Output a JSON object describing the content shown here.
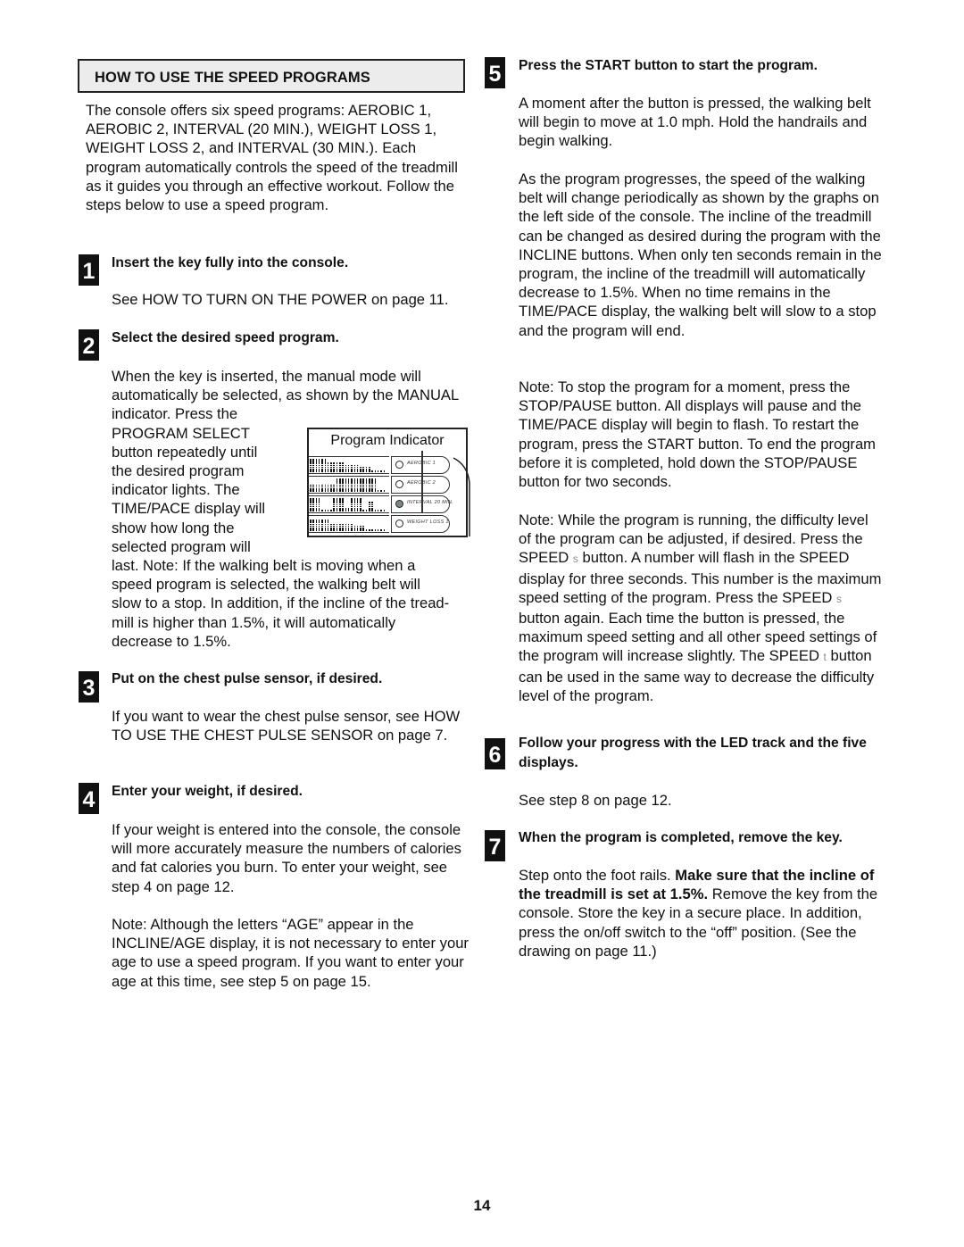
{
  "section_header": "HOW TO USE THE SPEED PROGRAMS",
  "intro": "The console offers six speed programs: AEROBIC 1, AEROBIC 2, INTERVAL (20 MIN.), WEIGHT LOSS 1, WEIGHT LOSS 2, and INTERVAL (30 MIN.). Each program automatically controls the speed of the treadmill as it guides you through an effective workout. Follow the steps below to use a speed program.",
  "steps": [
    {
      "number": "1",
      "title": "Insert the key fully into the console.",
      "body": [
        "See HOW TO TURN ON THE POWER on page 11."
      ]
    },
    {
      "number": "2",
      "title": "Select the desired speed program.",
      "body_lines": [
        "When the key is inserted, the manual mode will",
        "automatically be selected, as shown by the MANUAL",
        "indicator. Press the",
        "PROGRAM SELECT",
        "button repeatedly until",
        "the desired program",
        "indicator lights. The",
        "TIME/PACE display will",
        "show how long the",
        "selected program will",
        "last. Note: If the walking belt is moving when a",
        "speed program is selected, the walking belt will",
        "slow to a stop. In addition, if the incline of the tread-",
        "mill is higher than 1.5%, it will automatically",
        "decrease to 1.5%."
      ]
    },
    {
      "number": "3",
      "title": "Put on the chest pulse sensor, if desired.",
      "body": [
        "If you want to wear the chest pulse sensor, see HOW TO USE THE CHEST PULSE SENSOR on page 7."
      ]
    },
    {
      "number": "4",
      "title": "Enter your weight, if desired.",
      "body": [
        "If your weight is entered into the console, the console will more accurately measure the numbers of calories and fat calories you burn. To enter your weight, see step 4 on page 12.",
        "Note: Although the letters “AGE” appear in the INCLINE/AGE display, it is not necessary to enter your age to use a speed program. If you want to enter your age at this time, see step 5 on page 15."
      ]
    },
    {
      "number": "5",
      "title": "Press the START button to start the program.",
      "body": [
        "A moment after the button is pressed, the walking belt will begin to move at 1.0 mph. Hold the handrails and begin walking.",
        "As the program progresses, the speed of the walking belt will change periodically as shown by the graphs on the left side of the console. The incline of the treadmill can be changed as desired during the program with the INCLINE buttons. When only ten seconds remain in the program, the incline of the treadmill will automatically decrease to 1.5%. When no time remains in the TIME/PACE display, the walking belt will slow to a stop and the program will end.",
        "Note: To stop the program for a moment, press the STOP/PAUSE button. All displays will pause and the TIME/PACE display will begin to flash. To restart the program, press the START button. To end the program before it is completed, hold down the STOP/PAUSE button for two seconds."
      ],
      "speed_note": {
        "part1": "Note: While the program is running, the difficulty level of the program can be adjusted, if desired. Press the SPEED ",
        "up_glyph": "s",
        "part2": " button. A number will flash in the SPEED display for three seconds. This number is the maximum speed setting of the program. Press the SPEED ",
        "part3": " button again. Each time the button is pressed, the maximum speed setting and all other speed settings of the program will increase slightly. The SPEED ",
        "down_glyph": "t",
        "part4": " button can be used in the same way to decrease the difficulty level of the program."
      }
    },
    {
      "number": "6",
      "title": "Follow your progress with the LED track and the five displays.",
      "body": [
        "See step 8 on page 12."
      ]
    },
    {
      "number": "7",
      "title": "When the program is completed, remove the key.",
      "body_rich": {
        "pre": "Step onto the foot rails. ",
        "bold": "Make sure that the incline of the treadmill is set at 1.5%.",
        "post": " Remove the key from the console. Store the key in a secure place. In addition, press the on/off switch to the “off” position. (See the drawing on page 11.)"
      }
    }
  ],
  "figure": {
    "title": "Program Indicator",
    "programs": [
      {
        "label": "AEROBIC 1",
        "lit": false,
        "profile": [
          7,
          7,
          7,
          7,
          7,
          7,
          5,
          5,
          5,
          5,
          5,
          5,
          4,
          4,
          4,
          4,
          4,
          3,
          3,
          3,
          3,
          1,
          1,
          1,
          1,
          1
        ]
      },
      {
        "label": "AEROBIC 2",
        "lit": false,
        "profile": [
          4,
          4,
          4,
          4,
          4,
          4,
          4,
          4,
          4,
          7,
          7,
          7,
          7,
          7,
          7,
          7,
          7,
          7,
          7,
          7,
          7,
          7,
          7,
          1,
          1,
          1
        ]
      },
      {
        "label": "INTERVAL 20 MIN.",
        "lit": true,
        "profile": [
          7,
          7,
          7,
          7,
          1,
          1,
          1,
          1,
          7,
          7,
          7,
          7,
          2,
          2,
          7,
          7,
          7,
          7,
          1,
          1,
          5,
          5,
          1,
          1,
          1,
          1
        ]
      },
      {
        "label": "WEIGHT LOSS 1",
        "lit": false,
        "profile": [
          6,
          6,
          6,
          6,
          6,
          6,
          6,
          4,
          4,
          4,
          4,
          4,
          4,
          4,
          4,
          3,
          3,
          3,
          3,
          1,
          1,
          1,
          1,
          1,
          1,
          1
        ]
      }
    ]
  },
  "page_number": "14"
}
